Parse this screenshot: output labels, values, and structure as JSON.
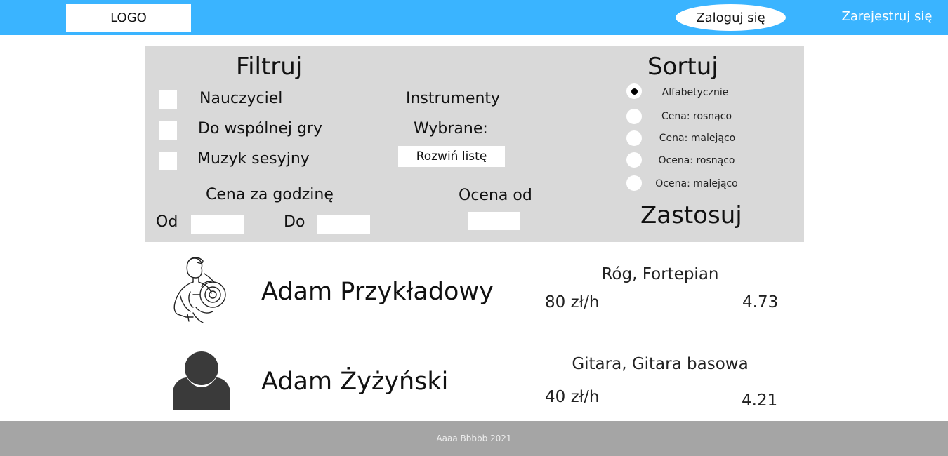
{
  "header": {
    "logo": "LOGO",
    "login": "Zaloguj się",
    "register": "Zarejestruj się"
  },
  "filter": {
    "title": "Filtruj",
    "checkboxes": [
      "Nauczyciel",
      "Do wspólnej gry",
      "Muzyk sesyjny"
    ],
    "instruments_label": "Instrumenty",
    "selected_label": "Wybrane:",
    "dropdown_label": "Rozwiń listę",
    "price_label": "Cena za godzinę",
    "price_from": "Od",
    "price_to": "Do",
    "rating_label": "Ocena od"
  },
  "sort": {
    "title": "Sortuj",
    "options": [
      "Alfabetycznie",
      "Cena: rosnąco",
      "Cena: malejąco",
      "Ocena: rosnąco",
      "Ocena: malejąco"
    ],
    "selected": "Alfabetycznie",
    "apply": "Zastosuj"
  },
  "results": [
    {
      "name": "Adam Przykładowy",
      "instruments": "Róg, Fortepian",
      "price": "80 zł/h",
      "rating": "4.73",
      "avatar": "horn-player-drawing"
    },
    {
      "name": "Adam Żyżyński",
      "instruments": "Gitara, Gitara basowa",
      "price": "40 zł/h",
      "rating": "4.21",
      "avatar": "default-user-icon"
    }
  ],
  "footer": {
    "text": "Aaaa Bbbbb 2021"
  }
}
